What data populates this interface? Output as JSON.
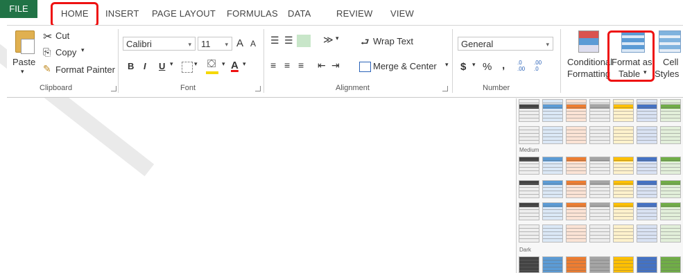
{
  "tabs": [
    "FILE",
    "HOME",
    "INSERT",
    "PAGE LAYOUT",
    "FORMULAS",
    "DATA",
    "REVIEW",
    "VIEW"
  ],
  "clipboard": {
    "paste": "Paste",
    "cut": "Cut",
    "copy": "Copy",
    "format_painter": "Format Painter",
    "label": "Clipboard"
  },
  "font": {
    "name": "Calibri",
    "size": "11",
    "bold": "B",
    "italic": "I",
    "underline": "U",
    "grow": "A",
    "shrink": "A",
    "font_color": "A",
    "label": "Font"
  },
  "alignment": {
    "wrap": "Wrap Text",
    "merge": "Merge & Center",
    "label": "Alignment"
  },
  "number": {
    "format": "General",
    "currency": "$",
    "percent": "%",
    "comma": ",",
    "inc_dec": ".0 .00",
    "dec_dec": ".00 .0",
    "label": "Number"
  },
  "styles": {
    "conditional_1": "Conditional",
    "conditional_2": "Formatting",
    "table_1": "Format as",
    "table_2": "Table",
    "cell_1": "Cell",
    "cell_2": "Styles"
  },
  "gallery": {
    "medium": "Medium",
    "dark": "Dark"
  },
  "colors": {
    "excel_green": "#217346",
    "highlight_red": "#e11111"
  }
}
